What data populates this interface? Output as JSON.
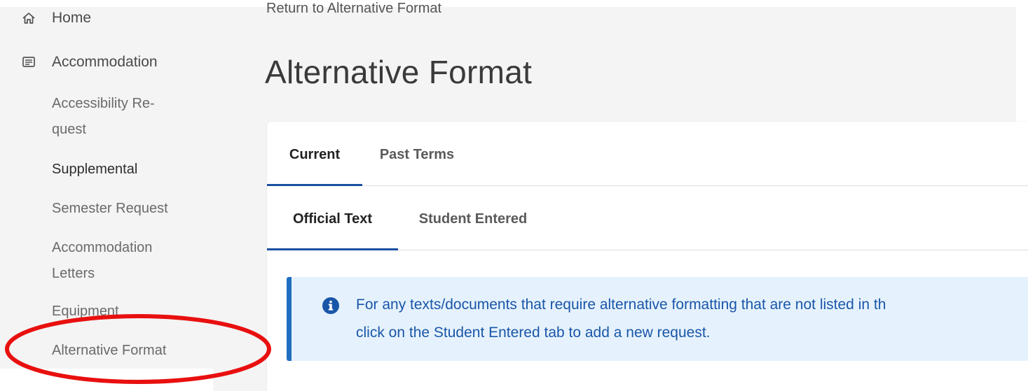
{
  "sidebar": {
    "items": [
      {
        "label": "Home",
        "icon": "home-icon"
      },
      {
        "label": "Accommodation",
        "icon": "list-icon"
      }
    ],
    "subitems": [
      {
        "label": "Accessibility Re-\nquest"
      },
      {
        "label": "Supplemental"
      },
      {
        "label": "Semester Request"
      },
      {
        "label": "Accommodation\nLetters"
      },
      {
        "label": "Equipment"
      },
      {
        "label": "Alternative Format"
      }
    ]
  },
  "breadcrumb": "Return to Alternative Format",
  "page_title": "Alternative Format",
  "tabs": [
    {
      "label": "Current"
    },
    {
      "label": "Past Terms"
    }
  ],
  "subtabs": [
    {
      "label": "Official Text"
    },
    {
      "label": "Student Entered"
    }
  ],
  "alert": {
    "line1": "For any texts/documents that require alternative formatting that are not listed in th",
    "line2": "click on the Student Entered tab to add a new request.",
    "icon": "info-icon"
  },
  "colors": {
    "accent": "#1a4fa0",
    "alert_bg": "#e5f2fd",
    "alert_text": "#1a56a8",
    "annotation": "#e8100f"
  }
}
